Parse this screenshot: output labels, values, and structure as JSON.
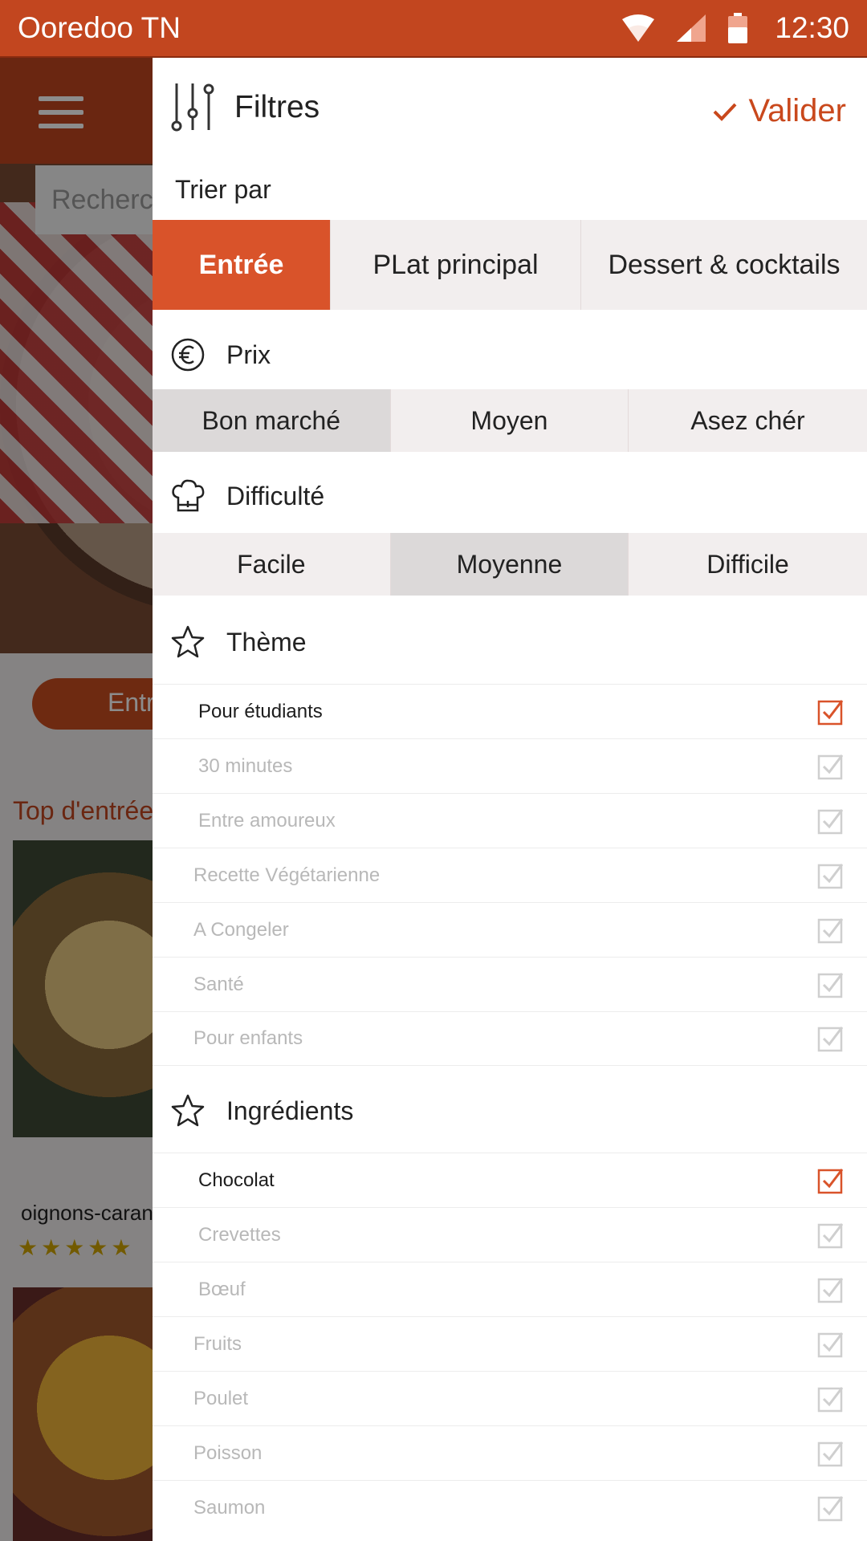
{
  "status_bar": {
    "carrier": "Ooredoo TN",
    "time": "12:30",
    "icons": [
      "wifi-icon",
      "signal-icon",
      "battery-icon"
    ]
  },
  "background": {
    "search_placeholder": "Recherc",
    "pill_label": "Entr",
    "section_title": "Top d'entrée",
    "card_caption": "oignons-caran",
    "stars": "★★★★★"
  },
  "drawer": {
    "title": "Filtres",
    "validate_label": "Valider",
    "sort_label": "Trier par",
    "sort_options": [
      "Entrée",
      "PLat principal",
      "Dessert & cocktails"
    ],
    "sort_selected": "Entrée",
    "price": {
      "title": "Prix",
      "options": [
        "Bon marché",
        "Moyen",
        "Asez chér"
      ],
      "selected": "Bon marché"
    },
    "difficulty": {
      "title": "Difficulté",
      "options": [
        "Facile",
        "Moyenne",
        "Difficile"
      ],
      "selected": "Moyenne"
    },
    "theme": {
      "title": "Thème",
      "items": [
        {
          "label": "Pour étudiants",
          "checked": true
        },
        {
          "label": "30 minutes",
          "checked": false
        },
        {
          "label": "Entre amoureux",
          "checked": false
        },
        {
          "label": "Recette Végétarienne",
          "checked": false
        },
        {
          "label": "A Congeler",
          "checked": false
        },
        {
          "label": "Santé",
          "checked": false
        },
        {
          "label": "Pour enfants",
          "checked": false
        }
      ]
    },
    "ingredients": {
      "title": "Ingrédients",
      "items": [
        {
          "label": "Chocolat",
          "checked": true
        },
        {
          "label": "Crevettes",
          "checked": false
        },
        {
          "label": "Bœuf",
          "checked": false
        },
        {
          "label": "Fruits",
          "checked": false
        },
        {
          "label": "Poulet",
          "checked": false
        },
        {
          "label": "Poisson",
          "checked": false
        },
        {
          "label": "Saumon",
          "checked": false
        }
      ]
    }
  },
  "colors": {
    "accent": "#d9532a",
    "status_bar": "#c2461f",
    "segment_bg": "#f2eeee",
    "segment_selected": "#dcd9d9"
  }
}
